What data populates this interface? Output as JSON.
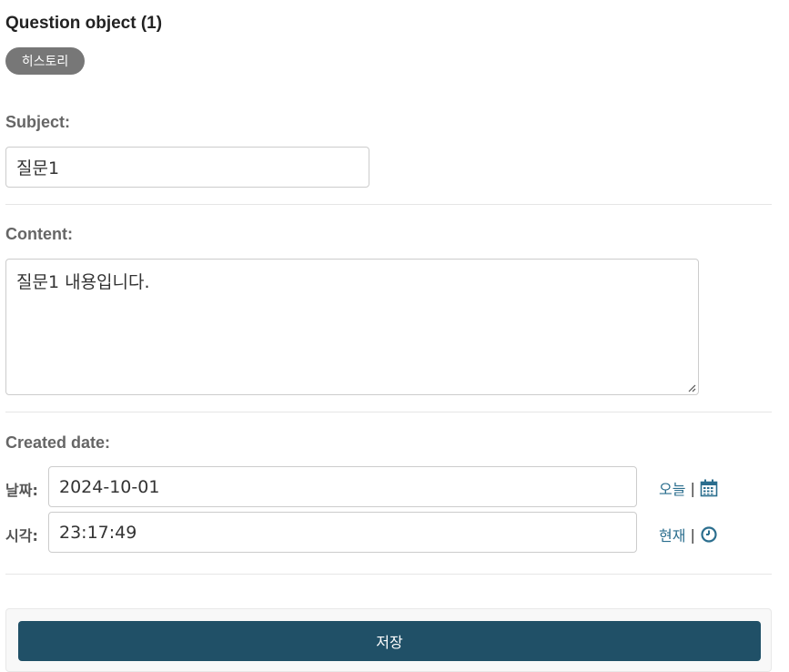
{
  "page": {
    "title": "Question object (1)",
    "history_button": "히스토리"
  },
  "fields": {
    "subject": {
      "label": "Subject:",
      "value": "질문1"
    },
    "content": {
      "label": "Content:",
      "value": "질문1 내용입니다."
    },
    "created_date": {
      "label": "Created date:",
      "date_label": "날짜:",
      "date_value": "2024-10-01",
      "today_link": "오늘",
      "time_label": "시각:",
      "time_value": "23:17:49",
      "now_link": "현재",
      "separator": "|",
      "calendar_icon": "calendar-icon",
      "clock_icon": "clock-icon"
    }
  },
  "actions": {
    "save_label": "저장"
  },
  "colors": {
    "accent": "#2b6e8e",
    "save_button": "#205067",
    "history_button": "#777777"
  }
}
